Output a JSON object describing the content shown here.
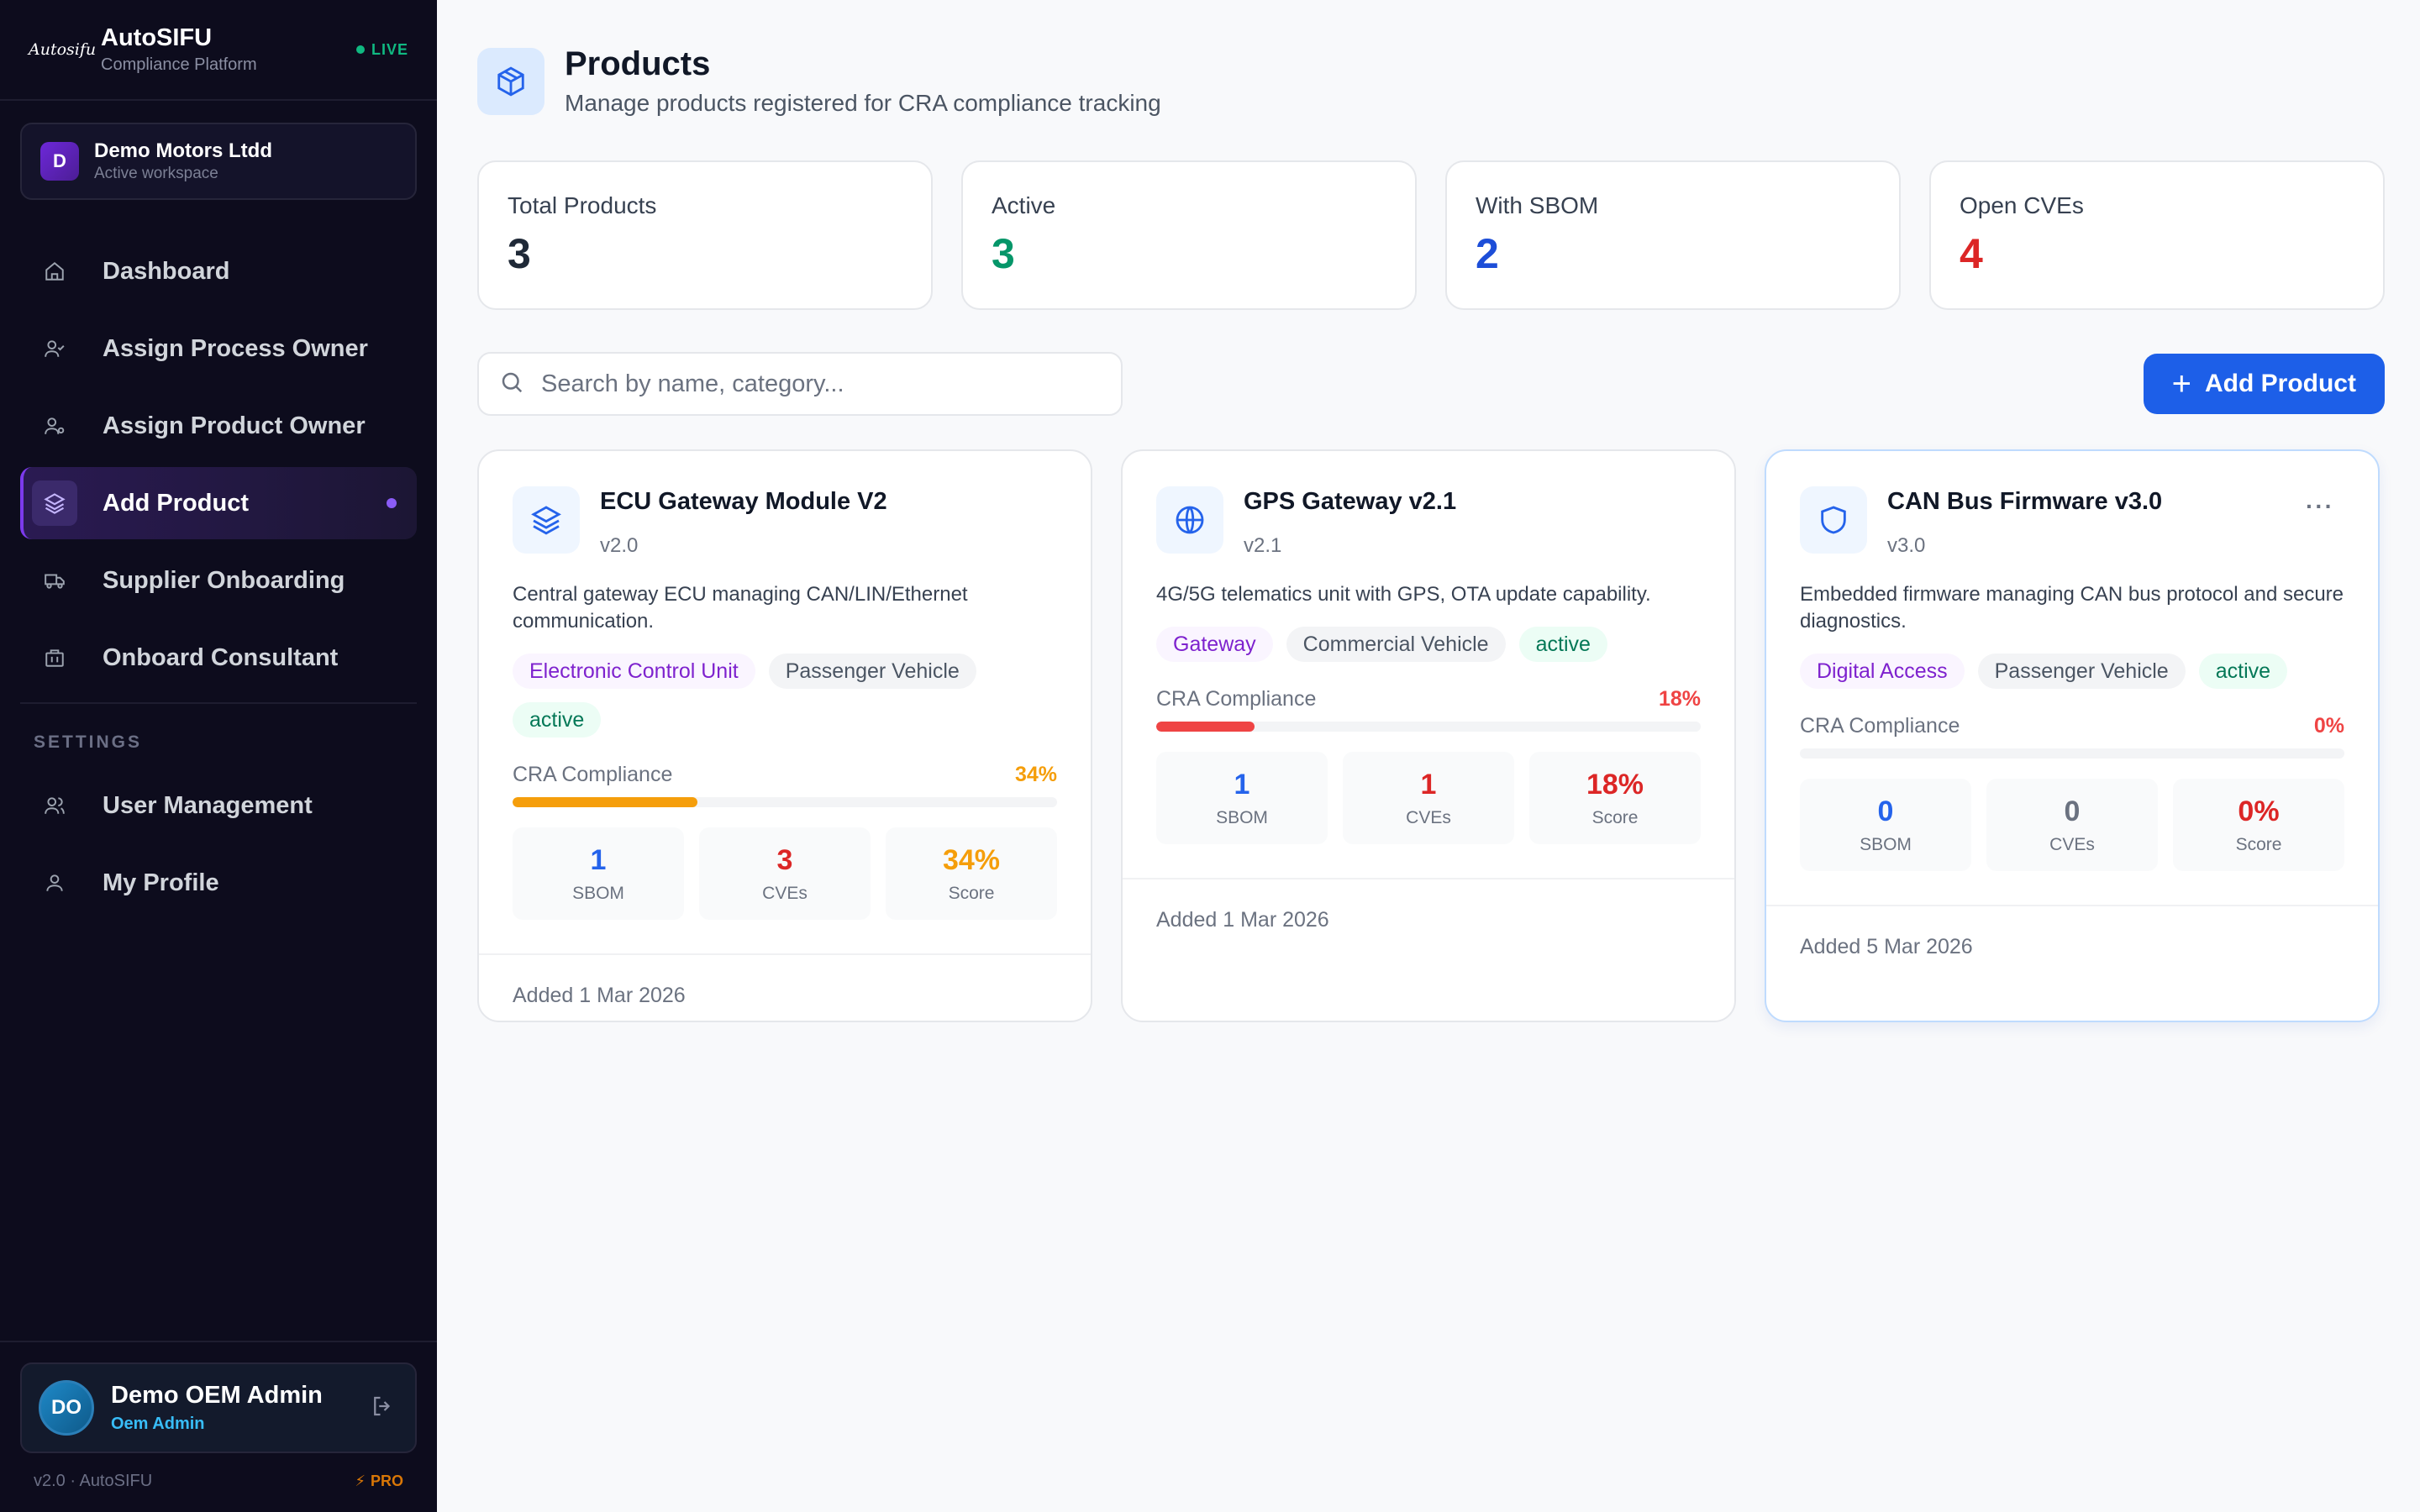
{
  "sidebar": {
    "logo_text": "Autosifu",
    "brand_name": "AutoSIFU",
    "brand_sub": "Compliance Platform",
    "live_label": "LIVE",
    "workspace": {
      "initial": "D",
      "name": "Demo Motors Ltdd",
      "sub": "Active workspace"
    },
    "nav": [
      {
        "label": "Dashboard",
        "icon": "home-icon"
      },
      {
        "label": "Assign Process Owner",
        "icon": "user-check-icon"
      },
      {
        "label": "Assign Product Owner",
        "icon": "user-cog-icon"
      },
      {
        "label": "Add Product",
        "icon": "layers-icon",
        "active": true
      },
      {
        "label": "Supplier Onboarding",
        "icon": "truck-icon"
      },
      {
        "label": "Onboard Consultant",
        "icon": "briefcase-icon"
      }
    ],
    "settings_label": "SETTINGS",
    "settings_nav": [
      {
        "label": "User Management",
        "icon": "users-icon"
      },
      {
        "label": "My Profile",
        "icon": "user-icon"
      }
    ],
    "user": {
      "initials": "DO",
      "name": "Demo OEM Admin",
      "role": "Oem Admin"
    },
    "version": "v2.0 · AutoSIFU",
    "plan": "PRO"
  },
  "header": {
    "title": "Products",
    "subtitle": "Manage products registered for CRA compliance tracking"
  },
  "stats": [
    {
      "label": "Total Products",
      "value": "3",
      "color": "#1f2937"
    },
    {
      "label": "Active",
      "value": "3",
      "color": "#059669"
    },
    {
      "label": "With SBOM",
      "value": "2",
      "color": "#1d4ed8"
    },
    {
      "label": "Open CVEs",
      "value": "4",
      "color": "#dc2626"
    }
  ],
  "search": {
    "placeholder": "Search by name, category...",
    "value": ""
  },
  "add_button_label": "Add Product",
  "labels": {
    "compliance": "CRA Compliance",
    "sbom": "SBOM",
    "cves": "CVEs",
    "score": "Score"
  },
  "products": [
    {
      "name": "ECU Gateway Module V2",
      "version": "v2.0",
      "description": "Central gateway ECU managing CAN/LIN/Ethernet communication.",
      "category": "Electronic Control Unit",
      "vehicle": "Passenger Vehicle",
      "status": "active",
      "compliance": "34%",
      "compliance_fraction": 0.34,
      "compliance_color": "#f59e0b",
      "sbom": "1",
      "cves": "3",
      "score": "34%",
      "added": "Added 1 Mar 2026",
      "icon": "layers-icon"
    },
    {
      "name": "GPS Gateway v2.1",
      "version": "v2.1",
      "description": "4G/5G telematics unit with GPS, OTA update capability.",
      "category": "Gateway",
      "vehicle": "Commercial Vehicle",
      "status": "active",
      "compliance": "18%",
      "compliance_fraction": 0.18,
      "compliance_color": "#ef4444",
      "sbom": "1",
      "cves": "1",
      "score": "18%",
      "added": "Added 1 Mar 2026",
      "icon": "globe-icon"
    },
    {
      "name": "CAN Bus Firmware v3.0",
      "version": "v3.0",
      "description": "Embedded firmware managing CAN bus protocol and secure diagnostics.",
      "category": "Digital Access",
      "vehicle": "Passenger Vehicle",
      "status": "active",
      "compliance": "0%",
      "compliance_fraction": 0,
      "compliance_color": "#ef4444",
      "sbom": "0",
      "cves": "0",
      "score": "0%",
      "added": "Added 5 Mar 2026",
      "icon": "shield-icon",
      "more_label": "···"
    }
  ]
}
